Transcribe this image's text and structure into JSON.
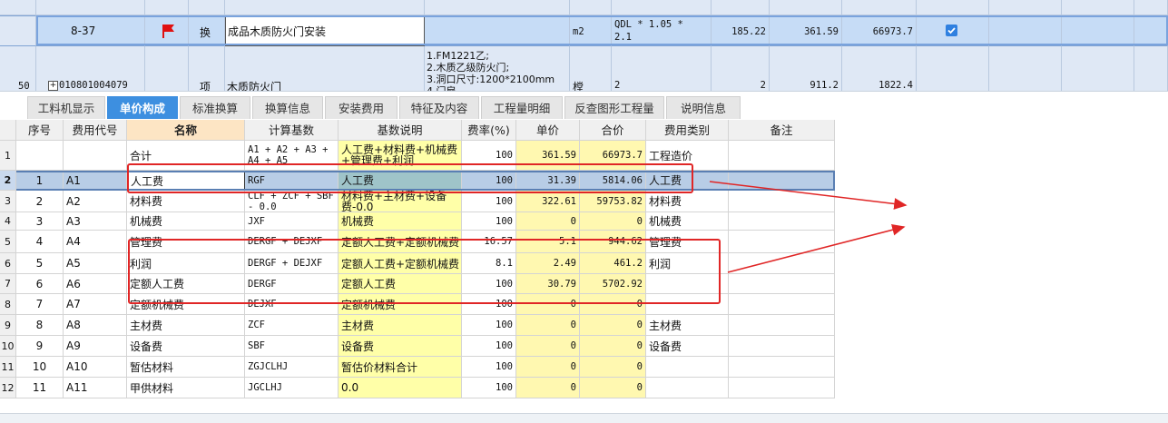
{
  "top_grid": {
    "selected_row": {
      "code": "8-37",
      "flag": "flag-icon",
      "type": "换",
      "name": "成品木质防火门安装",
      "unit": "m2",
      "formula_line1": "QDL * 1.05 *",
      "formula_line2": "2.1",
      "qty": "185.22",
      "price": "361.59",
      "total": "66973.7",
      "checked": true
    },
    "next_row": {
      "row_no": "50",
      "expand": "+",
      "code": "010801004079",
      "type": "项",
      "name": "木质防火门",
      "desc_line1": "1.FM1221乙;",
      "desc_line2": "2.木质乙级防火门;",
      "desc_line3": "3.洞口尺寸:1200*2100mm",
      "desc_line4": "4.门扇",
      "unit": "樘",
      "formula": "2",
      "qty": "2",
      "price": "911.2",
      "total": "1822.4"
    }
  },
  "tabs": [
    "工料机显示",
    "单价构成",
    "标准换算",
    "换算信息",
    "安装费用",
    "特征及内容",
    "工程量明细",
    "反查图形工程量",
    "说明信息"
  ],
  "active_tab": 1,
  "table": {
    "headers": [
      "序号",
      "费用代号",
      "名称",
      "计算基数",
      "基数说明",
      "费率(%)",
      "单价",
      "合价",
      "费用类别",
      "备注"
    ],
    "rows": [
      {
        "r": "1",
        "seq": "",
        "code": "",
        "name": "合计",
        "base1": "A1 + A2 + A3 +",
        "base2": "A4 + A5",
        "desc1": "人工费+材料费+机械费",
        "desc2": "+管理费+利润",
        "rate": "100",
        "price": "361.59",
        "total": "66973.7",
        "cat": "工程造价"
      },
      {
        "r": "2",
        "seq": "1",
        "code": "A1",
        "name": "人工费",
        "base1": "RGF",
        "base2": "",
        "desc1": "人工费",
        "desc2": "",
        "rate": "100",
        "price": "31.39",
        "total": "5814.06",
        "cat": "人工费"
      },
      {
        "r": "3",
        "seq": "2",
        "code": "A2",
        "name": "材料费",
        "base1": "CLF + ZCF + SBF",
        "base2": "- 0.0",
        "desc1": "材料费+主材费+设备",
        "desc2": "费-0.0",
        "rate": "100",
        "price": "322.61",
        "total": "59753.82",
        "cat": "材料费"
      },
      {
        "r": "4",
        "seq": "3",
        "code": "A3",
        "name": "机械费",
        "base1": "JXF",
        "base2": "",
        "desc1": "机械费",
        "desc2": "",
        "rate": "100",
        "price": "0",
        "total": "0",
        "cat": "机械费"
      },
      {
        "r": "5",
        "seq": "4",
        "code": "A4",
        "name": "管理费",
        "base1": "DERGF + DEJXF",
        "base2": "",
        "desc1": "定额人工费+定额机械费",
        "desc2": "",
        "rate": "16.57",
        "price": "5.1",
        "total": "944.62",
        "cat": "管理费"
      },
      {
        "r": "6",
        "seq": "5",
        "code": "A5",
        "name": "利润",
        "base1": "DERGF + DEJXF",
        "base2": "",
        "desc1": "定额人工费+定额机械费",
        "desc2": "",
        "rate": "8.1",
        "price": "2.49",
        "total": "461.2",
        "cat": "利润"
      },
      {
        "r": "7",
        "seq": "6",
        "code": "A6",
        "name": "定额人工费",
        "base1": "DERGF",
        "base2": "",
        "desc1": "定额人工费",
        "desc2": "",
        "rate": "100",
        "price": "30.79",
        "total": "5702.92",
        "cat": ""
      },
      {
        "r": "8",
        "seq": "7",
        "code": "A7",
        "name": "定额机械费",
        "base1": "DEJXF",
        "base2": "",
        "desc1": "定额机械费",
        "desc2": "",
        "rate": "100",
        "price": "0",
        "total": "0",
        "cat": ""
      },
      {
        "r": "9",
        "seq": "8",
        "code": "A8",
        "name": "主材费",
        "base1": "ZCF",
        "base2": "",
        "desc1": "主材费",
        "desc2": "",
        "rate": "100",
        "price": "0",
        "total": "0",
        "cat": "主材费"
      },
      {
        "r": "10",
        "seq": "9",
        "code": "A9",
        "name": "设备费",
        "base1": "SBF",
        "base2": "",
        "desc1": "设备费",
        "desc2": "",
        "rate": "100",
        "price": "0",
        "total": "0",
        "cat": "设备费"
      },
      {
        "r": "11",
        "seq": "10",
        "code": "A10",
        "name": "暂估材料",
        "base1": "ZGJCLHJ",
        "base2": "",
        "desc1": "暂估价材料合计",
        "desc2": "",
        "rate": "100",
        "price": "0",
        "total": "0",
        "cat": ""
      },
      {
        "r": "12",
        "seq": "11",
        "code": "A11",
        "name": "甲供材料",
        "base1": "JGCLHJ",
        "base2": "",
        "desc1": "0.0",
        "desc2": "",
        "rate": "100",
        "price": "0",
        "total": "0",
        "cat": ""
      }
    ]
  },
  "colors": {
    "accent": "#3d8fe0",
    "annotation": "#e02626",
    "highlight": "#ffffa8",
    "price_col": "#fff8b0"
  }
}
